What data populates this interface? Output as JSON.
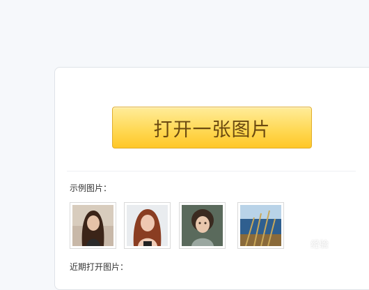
{
  "main": {
    "open_button_label": "打开一张图片",
    "examples_label": "示例图片：",
    "recent_label": "近期打开图片：",
    "thumbnails": [
      {
        "subject": "woman-long-dark-hair"
      },
      {
        "subject": "woman-red-hair"
      },
      {
        "subject": "child-curly-hair"
      },
      {
        "subject": "sea-and-grass"
      }
    ]
  },
  "watermark": {
    "text": "经验"
  },
  "colors": {
    "button_top": "#ffec9a",
    "button_bottom": "#ffc727",
    "button_text": "#6b4a10",
    "page_background": "#f6f8fb"
  }
}
